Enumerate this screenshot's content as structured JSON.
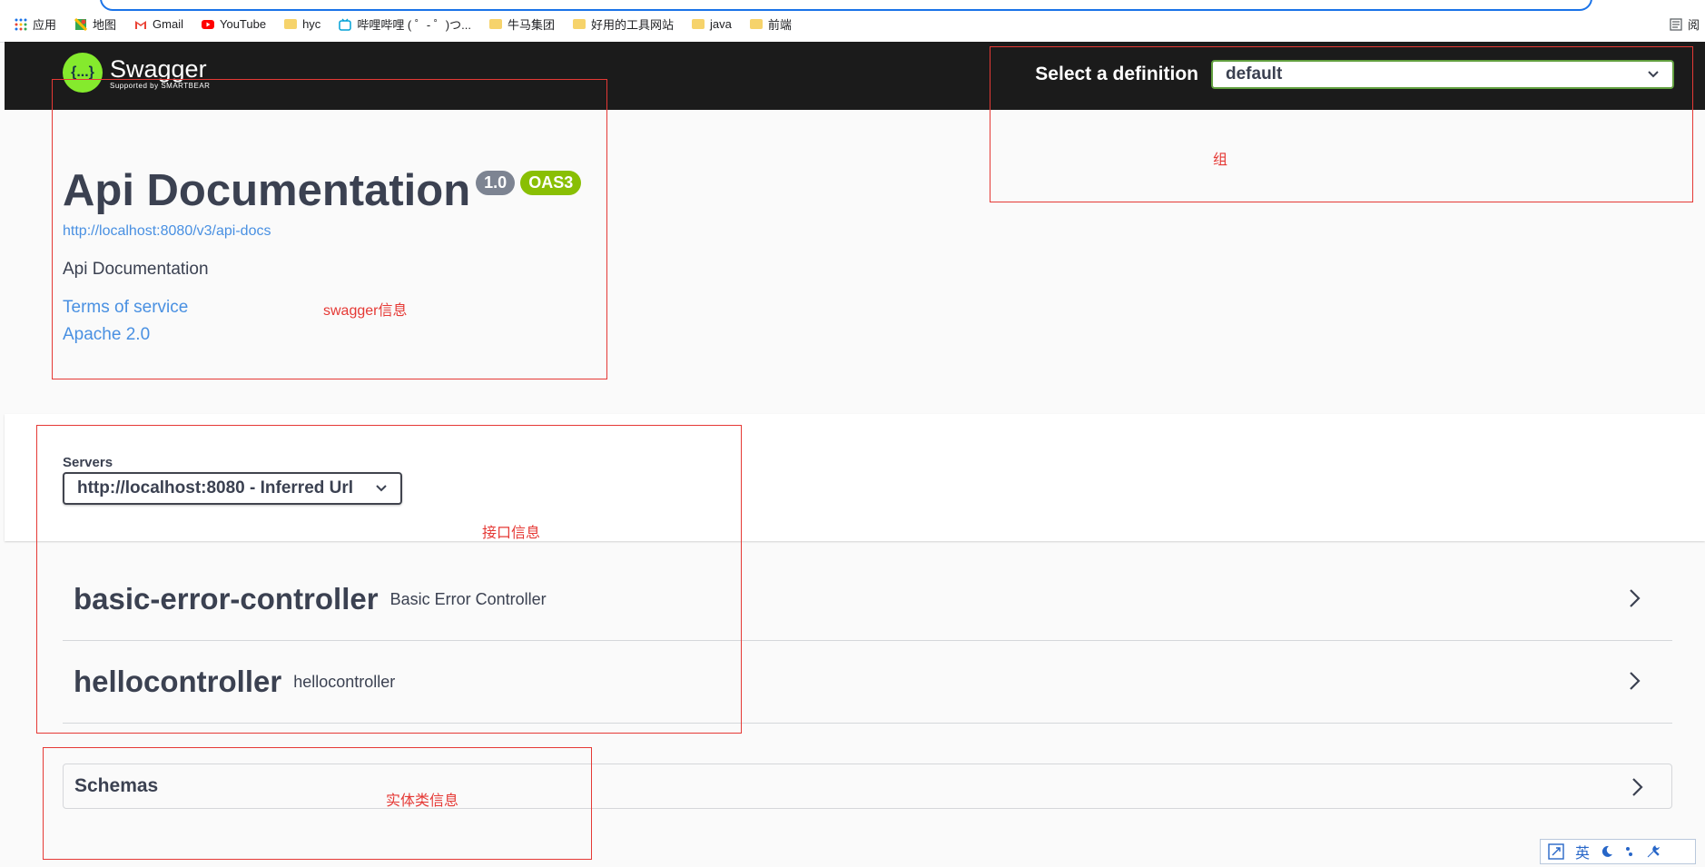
{
  "browser": {
    "bookmarks": [
      {
        "label": "应用",
        "icon": "apps-grid-icon"
      },
      {
        "label": "地图",
        "icon": "maps-icon"
      },
      {
        "label": "Gmail",
        "icon": "gmail-icon"
      },
      {
        "label": "YouTube",
        "icon": "youtube-icon"
      },
      {
        "label": "hyc",
        "icon": "folder-icon"
      },
      {
        "label": "哔哩哔哩 ( ゜- ゜)つ...",
        "icon": "bilibili-icon"
      },
      {
        "label": "牛马集团",
        "icon": "folder-icon"
      },
      {
        "label": "好用的工具网站",
        "icon": "folder-icon"
      },
      {
        "label": "java",
        "icon": "folder-icon"
      },
      {
        "label": "前端",
        "icon": "folder-icon"
      }
    ],
    "reading_list": "阅"
  },
  "topbar": {
    "logo_text": "Swagger",
    "logo_sub": "Supported by SMARTBEAR",
    "logo_glyph": "{...}",
    "select_label": "Select a definition",
    "select_value": "default"
  },
  "info": {
    "title": "Api Documentation",
    "version": "1.0",
    "oas": "OAS3",
    "url": "http://localhost:8080/v3/api-docs",
    "description": "Api Documentation",
    "terms": "Terms of service",
    "license": "Apache 2.0"
  },
  "servers": {
    "label": "Servers",
    "selected": "http://localhost:8080 - Inferred Url"
  },
  "tags": [
    {
      "name": "basic-error-controller",
      "description": "Basic Error Controller"
    },
    {
      "name": "hellocontroller",
      "description": "hellocontroller"
    }
  ],
  "schemas": {
    "label": "Schemas"
  },
  "annotations": {
    "group": "组",
    "swagger_info": "swagger信息",
    "api_info": "接口信息",
    "entity_info": "实体类信息"
  },
  "ime": {
    "lang": "英"
  },
  "colors": {
    "topbar": "#1b1b1b",
    "logo_green": "#85ea2d",
    "badge_version": "#7d8492",
    "badge_oas": "#89bf04",
    "link": "#4990e2",
    "annotation_red": "#e53935"
  }
}
